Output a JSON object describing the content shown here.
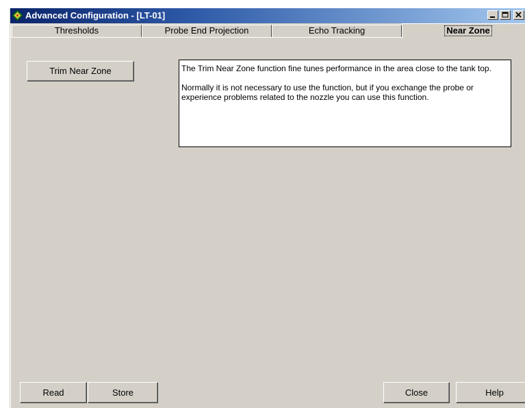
{
  "window": {
    "title": "Advanced Configuration - [LT-01]",
    "app_icon": "green-diamond-icon",
    "controls": [
      "minimize",
      "maximize",
      "close"
    ]
  },
  "tabs": [
    {
      "label": "Thresholds",
      "active": false
    },
    {
      "label": "Probe End Projection",
      "active": false
    },
    {
      "label": "Echo Tracking",
      "active": false
    },
    {
      "label": "Near Zone",
      "active": true
    }
  ],
  "near_zone": {
    "trim_button_label": "Trim Near Zone",
    "description_1": "The Trim Near Zone function fine tunes performance in the area close to the tank top.",
    "description_2": "Normally it is not necessary to use the function, but if you exchange the probe or experience problems related to the nozzle you can use this function."
  },
  "footer": {
    "read_label": "Read",
    "store_label": "Store",
    "close_label": "Close",
    "help_label": "Help"
  },
  "colors": {
    "titlebar_start": "#0a246a",
    "titlebar_end": "#a6caf0",
    "face": "#d4d0c8"
  }
}
